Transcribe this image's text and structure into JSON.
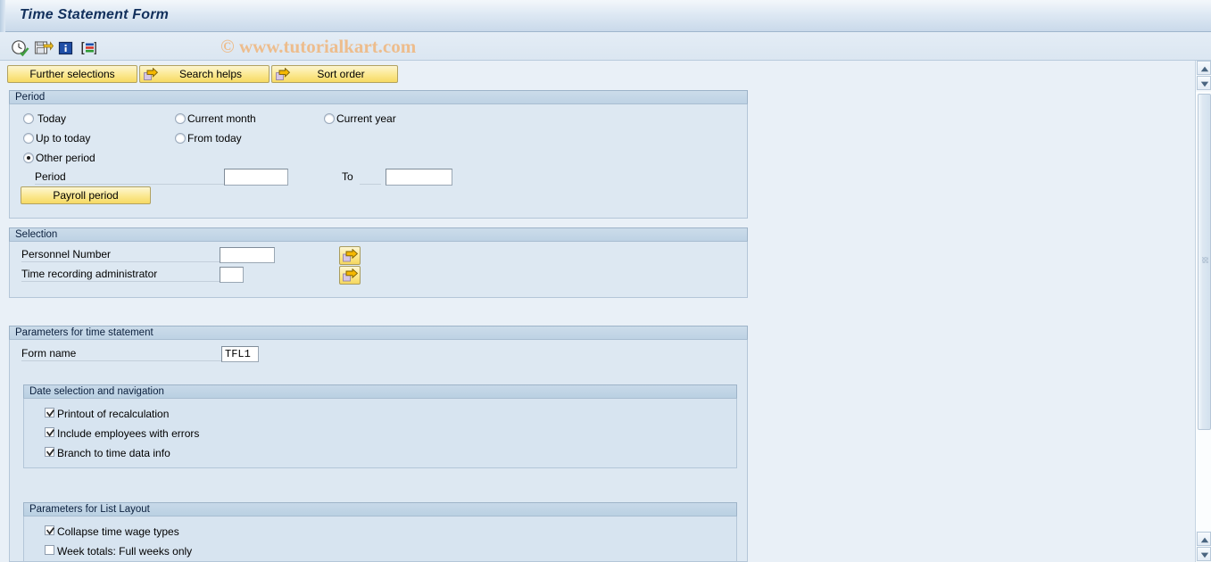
{
  "window": {
    "title": "Time Statement Form",
    "watermark": "© www.tutorialkart.com"
  },
  "colors": {
    "title_text": "#12305c",
    "titlebar_gradient_top": "#f3f7fb",
    "titlebar_gradient_bottom": "#c9d9ea",
    "button_yellow": "#fbe88f",
    "group_bg": "#dde8f2",
    "group_header": "#c3d6e7",
    "page_bg": "#e9f0f7",
    "watermark": "#edbd8d",
    "field_border": "#9aa7b4"
  },
  "toolbar": {
    "icons": [
      {
        "name": "execute-clock-icon",
        "title": "Execute"
      },
      {
        "name": "save-variant-icon",
        "title": "Get Variant"
      },
      {
        "name": "info-icon",
        "title": "Information"
      },
      {
        "name": "multi-selection-icon",
        "title": "Layout"
      }
    ]
  },
  "action_buttons": [
    {
      "label": "Further selections",
      "icon": null
    },
    {
      "label": "Search helps",
      "icon": "arrow-right-icon"
    },
    {
      "label": "Sort order",
      "icon": "arrow-right-icon"
    }
  ],
  "period_section": {
    "header": "Period",
    "radios": [
      {
        "label": "Today",
        "selected": false
      },
      {
        "label": "Current month",
        "selected": false
      },
      {
        "label": "Current year",
        "selected": false
      },
      {
        "label": "Up to today",
        "selected": false
      },
      {
        "label": "From today",
        "selected": false
      },
      {
        "label": "Other period",
        "selected": true
      }
    ],
    "period_label": "Period",
    "period_value": "",
    "to_label": "To",
    "to_value": "",
    "payroll_period_button": "Payroll period"
  },
  "selection_section": {
    "header": "Selection",
    "fields": [
      {
        "label": "Personnel Number",
        "value": "",
        "has_multi_select": true
      },
      {
        "label": "Time recording administrator",
        "value": "",
        "has_multi_select": true
      }
    ]
  },
  "time_statement_section": {
    "header": "Parameters for time statement",
    "form_name_label": "Form name",
    "form_name_value": "TFL1",
    "date_selection_group": {
      "header": "Date selection and navigation",
      "checkboxes": [
        {
          "label": "Printout of recalculation",
          "checked": true
        },
        {
          "label": "Include employees with errors",
          "checked": true
        },
        {
          "label": "Branch to time data info",
          "checked": true
        }
      ]
    },
    "list_layout_group": {
      "header": "Parameters for List Layout",
      "checkboxes": [
        {
          "label": "Collapse time wage types",
          "checked": true
        },
        {
          "label": "Week totals: Full weeks only",
          "checked": false
        }
      ]
    }
  },
  "scrollbar": {
    "vertical_up_label": "▲",
    "vertical_down_label": "▼"
  }
}
